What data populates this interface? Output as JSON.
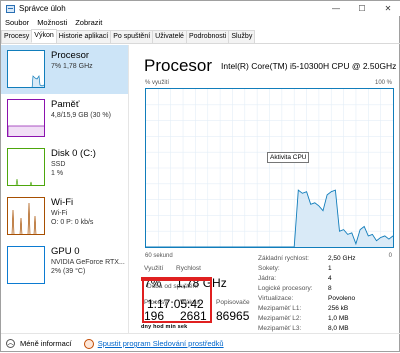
{
  "window": {
    "title": "Správce úloh",
    "controls": {
      "minimize": "—",
      "maximize": "☐",
      "close": "✕"
    }
  },
  "menu": [
    "Soubor",
    "Možnosti",
    "Zobrazit"
  ],
  "tabs": [
    "Procesy",
    "Výkon",
    "Historie aplikací",
    "Po spuštění",
    "Uživatelé",
    "Podrobnosti",
    "Služby"
  ],
  "active_tab": "Výkon",
  "sidebar": {
    "items": [
      {
        "title": "Procesor",
        "sub1": "7% 1,78 GHz",
        "sub2": "",
        "color": "#117dbb"
      },
      {
        "title": "Paměť",
        "sub1": "4,8/15,9 GB (30 %)",
        "sub2": "",
        "color": "#8b12ae"
      },
      {
        "title": "Disk 0 (C:)",
        "sub1": "SSD",
        "sub2": "1 %",
        "color": "#4da60c"
      },
      {
        "title": "Wi-Fi",
        "sub1": "Wi-Fi",
        "sub2": "O: 0 P: 0 kb/s",
        "color": "#a74f01"
      },
      {
        "title": "GPU 0",
        "sub1": "NVIDIA GeForce RTX...",
        "sub2": "2% (39 °C)",
        "color": "#0c7bd1"
      }
    ]
  },
  "main": {
    "title": "Procesor",
    "cpu_model": "Intel(R) Core(TM) i5-10300H CPU @ 2.50GHz",
    "graph_label_left": "% využití",
    "graph_label_right": "100 %",
    "graph_bottom_left": "60 sekund",
    "graph_bottom_right": "0",
    "tooltip": "Aktivita CPU",
    "graph_color": "#117dbb",
    "graph_fill": "#d9eaf7",
    "usage_series": [
      0,
      0,
      0,
      0,
      0,
      0,
      0,
      0,
      0,
      0,
      0,
      0,
      0,
      0,
      0,
      0,
      0,
      0,
      0,
      0,
      0,
      0,
      0,
      0,
      0,
      0,
      0,
      0,
      0,
      0,
      0,
      0,
      0,
      0,
      0,
      0,
      0,
      36,
      34,
      35,
      27,
      28,
      26,
      23,
      33,
      35,
      36,
      10,
      11,
      8,
      9,
      2,
      11,
      13,
      7,
      8,
      4,
      6,
      7,
      5,
      7
    ]
  },
  "stats": {
    "utilization_label": "Využití",
    "utilization_value": "7%",
    "speed_label": "Rychlost",
    "speed_value": "1,78 GHz",
    "processes_label": "Procesy",
    "processes_value": "196",
    "threads_label": "Vlákna",
    "threads_value": "2681",
    "handles_label": "Popisovače",
    "handles_value": "86965",
    "uptime_label": "Doba od spuštění",
    "uptime_value": "1:17:05:42",
    "uptime_units": "dny hod min sek"
  },
  "info": [
    {
      "label": "Základní rychlost:",
      "value": "2,50 GHz"
    },
    {
      "label": "Sokety:",
      "value": "1"
    },
    {
      "label": "Jádra:",
      "value": "4"
    },
    {
      "label": "Logické procesory:",
      "value": "8"
    },
    {
      "label": "Virtualizace:",
      "value": "Povoleno"
    },
    {
      "label": "Mezipaměť L1:",
      "value": "256 kB"
    },
    {
      "label": "Mezipaměť L2:",
      "value": "1,0 MB"
    },
    {
      "label": "Mezipaměť L3:",
      "value": "8,0 MB"
    }
  ],
  "footer": {
    "less_info": "Méně informací",
    "monitor_link": "Spustit program Sledování prostředků"
  }
}
